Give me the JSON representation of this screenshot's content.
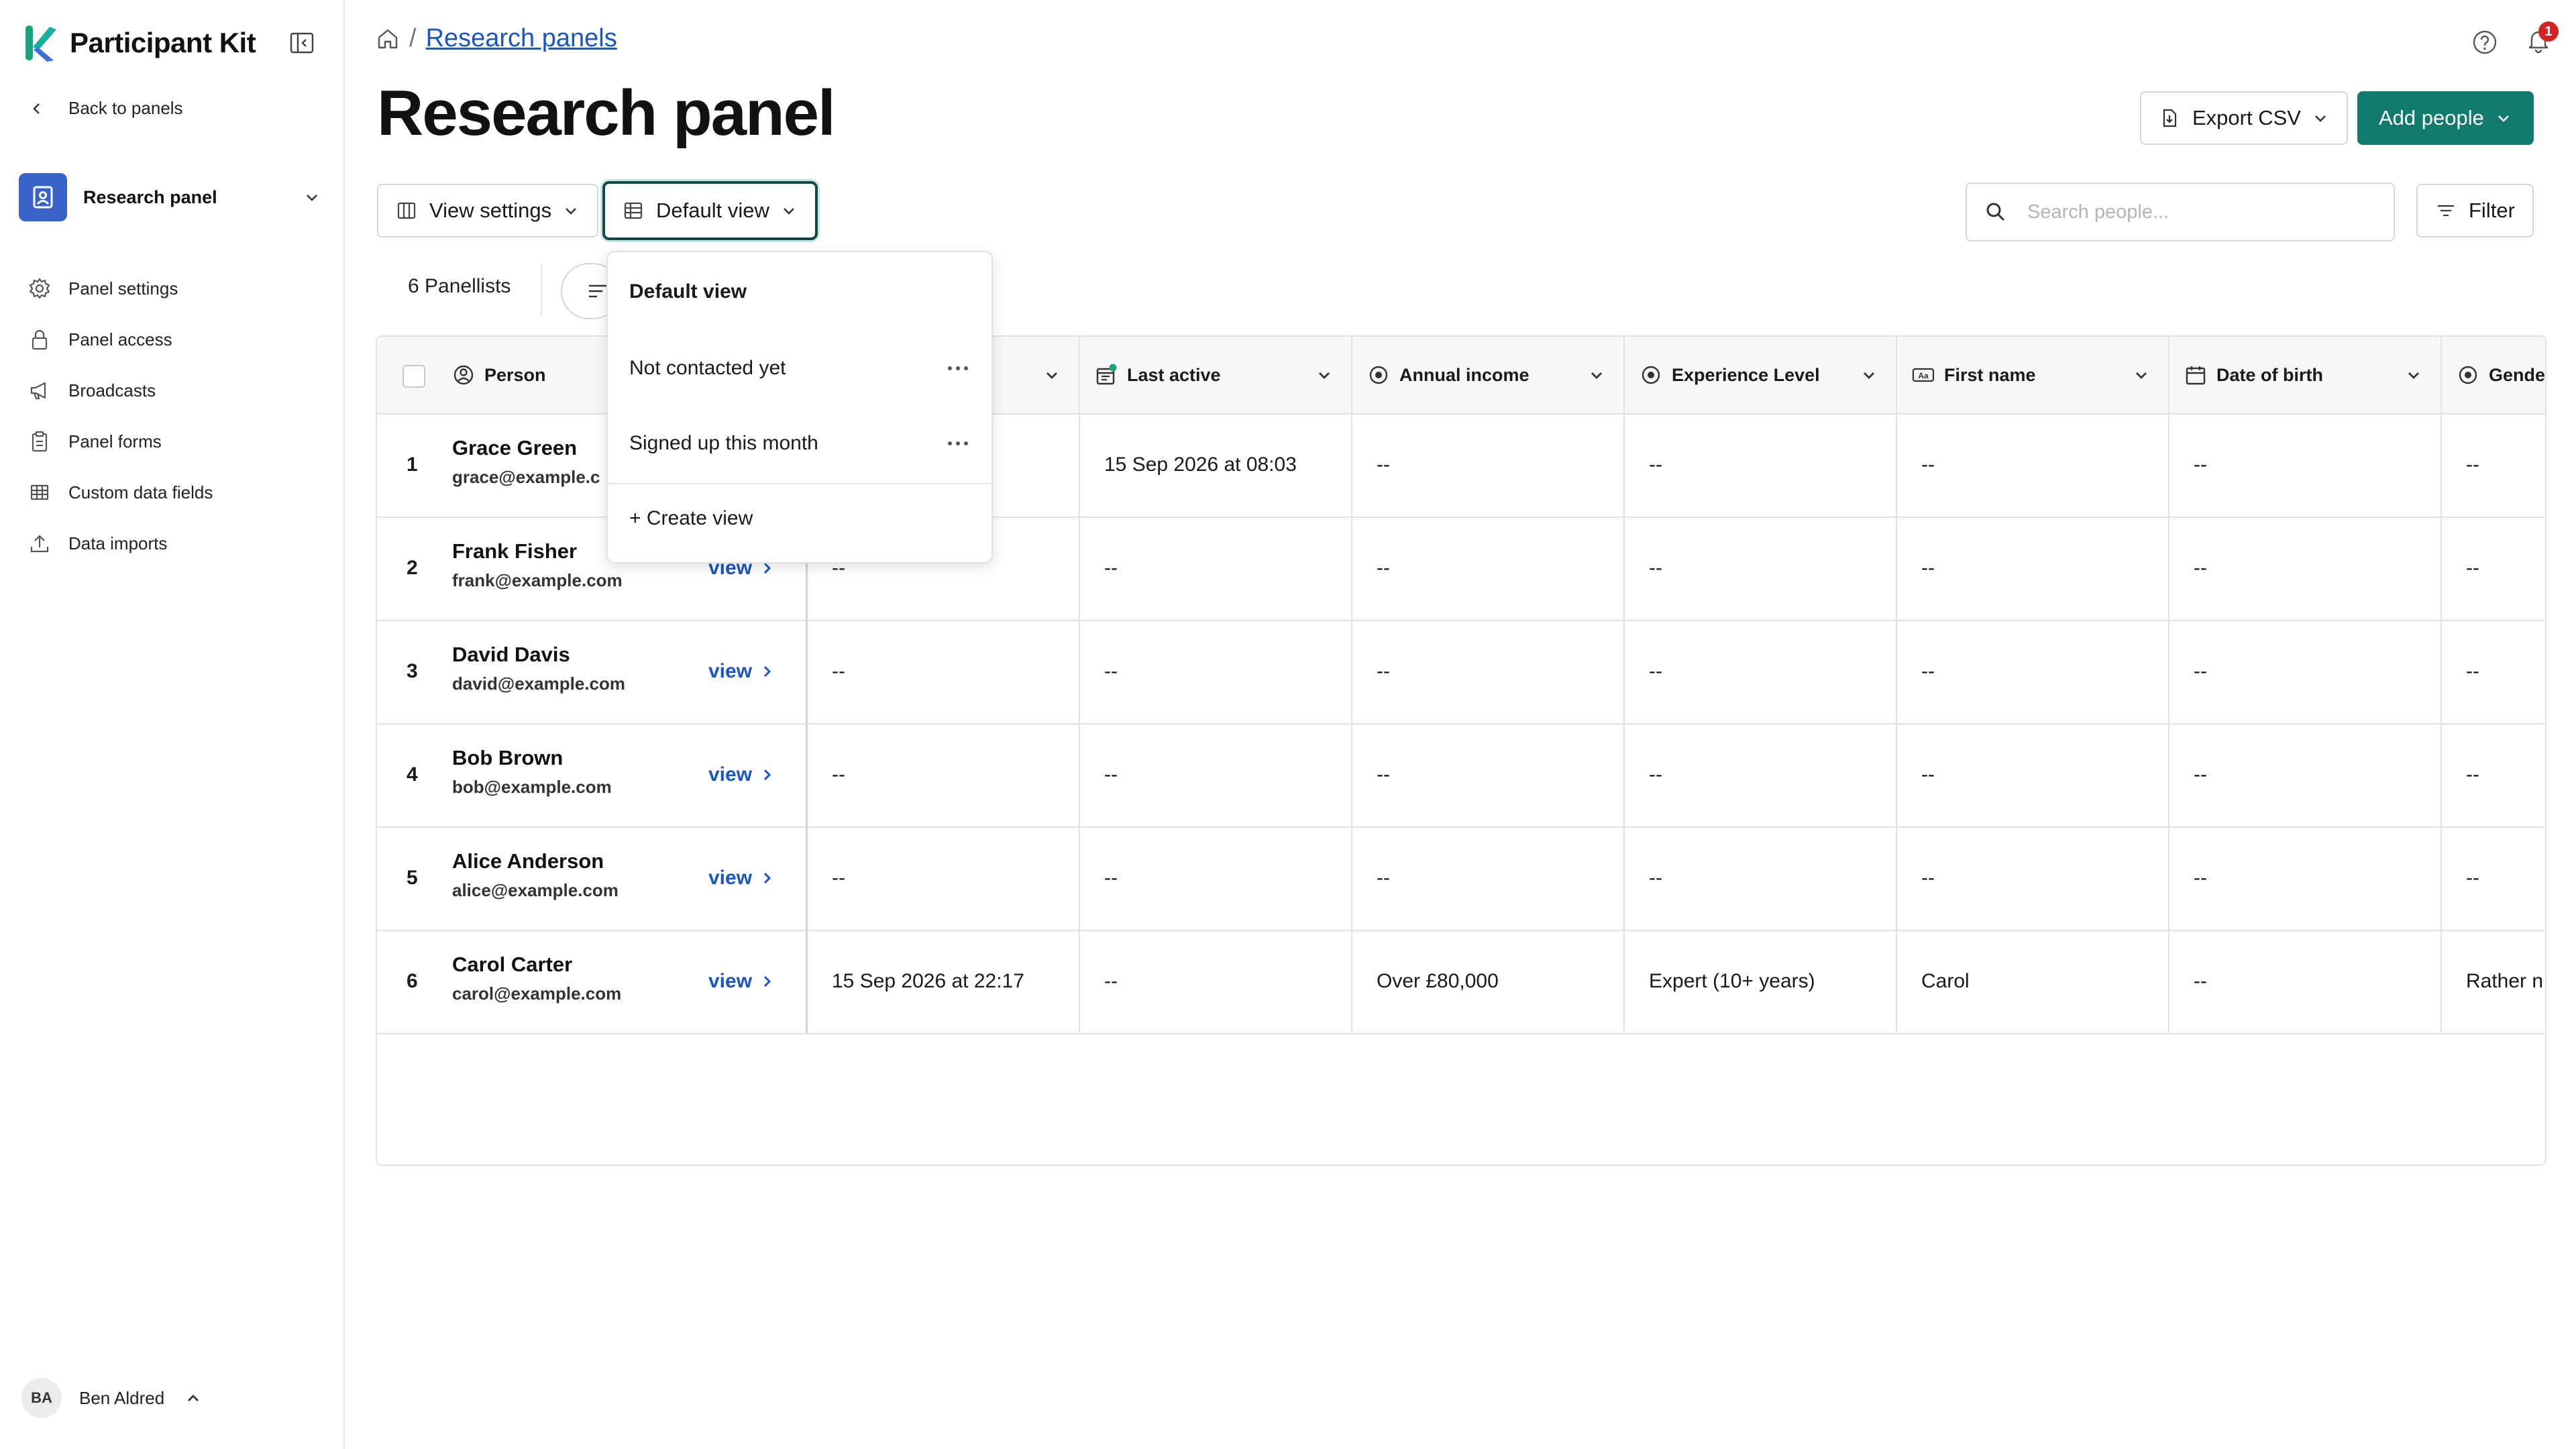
{
  "app": {
    "brand": "Participant Kit"
  },
  "sidebar": {
    "back_label": "Back to panels",
    "panel_name": "Research panel",
    "items": [
      {
        "label": "Panel settings",
        "icon": "gear-icon"
      },
      {
        "label": "Panel access",
        "icon": "lock-icon"
      },
      {
        "label": "Broadcasts",
        "icon": "megaphone-icon"
      },
      {
        "label": "Panel forms",
        "icon": "clipboard-icon"
      },
      {
        "label": "Custom data fields",
        "icon": "table-icon"
      },
      {
        "label": "Data imports",
        "icon": "upload-icon"
      }
    ],
    "user": {
      "initials": "BA",
      "name": "Ben Aldred"
    }
  },
  "header": {
    "crumb_sep": "/",
    "crumb_link": "Research panels",
    "title": "Research panel",
    "notification_count": "1",
    "export_label": "Export CSV",
    "add_label": "Add people"
  },
  "toolbar": {
    "view_settings_label": "View settings",
    "default_view_label": "Default view",
    "search_placeholder": "Search people...",
    "filter_label": "Filter",
    "panellist_count": "6 Panellists"
  },
  "views_menu": {
    "items": [
      "Default view",
      "Not contacted yet",
      "Signed up this month"
    ],
    "create_label": "+ Create view"
  },
  "table": {
    "columns": [
      "Person",
      "Last active",
      "Annual income",
      "Experience Level",
      "First name",
      "Date of birth",
      "Gende"
    ],
    "view_label": "view",
    "rows": [
      {
        "num": "1",
        "name": "Grace Green",
        "email": "grace@example.c",
        "c0": "",
        "c1": "15 Sep 2026 at 08:03",
        "c2": "--",
        "c3": "--",
        "c4": "--",
        "c5": "--",
        "c6": "--"
      },
      {
        "num": "2",
        "name": "Frank Fisher",
        "email": "frank@example.com",
        "c0": "--",
        "c1": "--",
        "c2": "--",
        "c3": "--",
        "c4": "--",
        "c5": "--",
        "c6": "--"
      },
      {
        "num": "3",
        "name": "David Davis",
        "email": "david@example.com",
        "c0": "--",
        "c1": "--",
        "c2": "--",
        "c3": "--",
        "c4": "--",
        "c5": "--",
        "c6": "--"
      },
      {
        "num": "4",
        "name": "Bob Brown",
        "email": "bob@example.com",
        "c0": "--",
        "c1": "--",
        "c2": "--",
        "c3": "--",
        "c4": "--",
        "c5": "--",
        "c6": "--"
      },
      {
        "num": "5",
        "name": "Alice Anderson",
        "email": "alice@example.com",
        "c0": "--",
        "c1": "--",
        "c2": "--",
        "c3": "--",
        "c4": "--",
        "c5": "--",
        "c6": "--"
      },
      {
        "num": "6",
        "name": "Carol Carter",
        "email": "carol@example.com",
        "c0": "15 Sep 2026 at 22:17",
        "c1": "--",
        "c2": "Over £80,000",
        "c3": "Expert (10+ years)",
        "c4": "Carol",
        "c5": "--",
        "c6": "Rather n"
      }
    ]
  },
  "colors": {
    "accent": "#117a6d",
    "link": "#1a56c4",
    "badge": "#d32424",
    "panel_icon_bg": "#3a63c9"
  }
}
